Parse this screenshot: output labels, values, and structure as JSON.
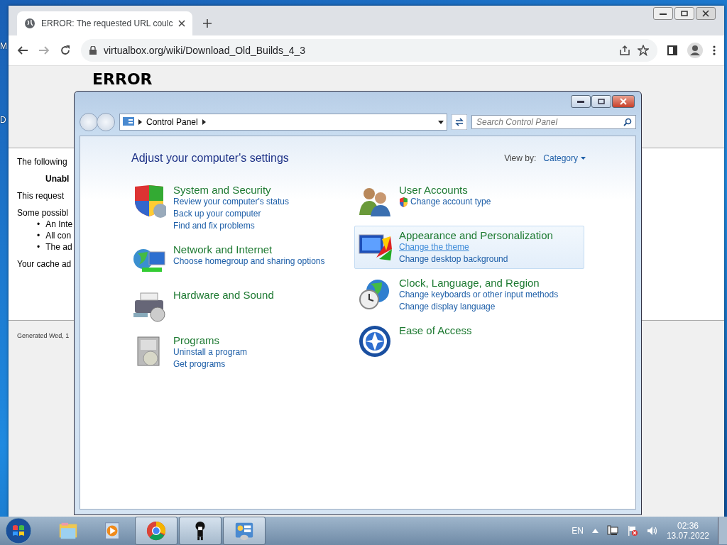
{
  "desktop": {
    "icon_labels": [
      "M",
      "D"
    ]
  },
  "browser": {
    "tabs": [
      {
        "title": "ERROR: The requested URL coulc",
        "selected": true
      }
    ],
    "address": "virtualbox.org/wiki/Download_Old_Builds_4_3",
    "page": {
      "heading": "ERROR",
      "lines": [
        {
          "kind": "para",
          "text": "The following"
        },
        {
          "kind": "bold",
          "text": "Unabl"
        },
        {
          "kind": "para",
          "text": "This request"
        },
        {
          "kind": "para",
          "text": "Some possibl"
        },
        {
          "kind": "bullet",
          "marker": "•",
          "text": "An Inte"
        },
        {
          "kind": "bullet",
          "marker": "•",
          "text": "All con"
        },
        {
          "kind": "bullet",
          "marker": "•",
          "text": "The ad"
        },
        {
          "kind": "para",
          "text": "Your cache ad"
        }
      ],
      "footer": "Generated Wed, 1"
    }
  },
  "control_panel": {
    "breadcrumb": [
      "Control Panel"
    ],
    "search": {
      "placeholder": "Search Control Panel"
    },
    "heading": "Adjust your computer's settings",
    "view_by": {
      "label": "View by:",
      "value": "Category"
    },
    "columns": [
      [
        {
          "title": "System and Security",
          "highlighted": false,
          "links": [
            {
              "text": "Review your computer's status",
              "kind": "plain",
              "hovered": false
            },
            {
              "text": "Back up your computer",
              "kind": "plain",
              "hovered": false
            },
            {
              "text": "Find and fix problems",
              "kind": "plain",
              "hovered": false
            }
          ]
        },
        {
          "title": "Network and Internet",
          "highlighted": false,
          "links": [
            {
              "text": "Choose homegroup and sharing options",
              "kind": "plain",
              "hovered": false
            }
          ]
        },
        {
          "title": "Hardware and Sound",
          "highlighted": false
        },
        {
          "title": "Programs",
          "highlighted": false,
          "links": [
            {
              "text": "Uninstall a program",
              "kind": "plain",
              "hovered": false
            },
            {
              "text": "Get programs",
              "kind": "plain",
              "hovered": false
            }
          ]
        }
      ],
      [
        {
          "title": "User Accounts",
          "highlighted": false,
          "links": [
            {
              "text": "Change account type",
              "kind": "shield",
              "hovered": false
            }
          ]
        },
        {
          "title": "Appearance and Personalization",
          "highlighted": true,
          "links": [
            {
              "text": "Change the theme",
              "kind": "plain",
              "hovered": true
            },
            {
              "text": "Change desktop background",
              "kind": "plain",
              "hovered": false
            }
          ]
        },
        {
          "title": "Clock, Language, and Region",
          "highlighted": false,
          "links": [
            {
              "text": "Change keyboards or other input methods",
              "kind": "plain",
              "hovered": false
            },
            {
              "text": "Change display language",
              "kind": "plain",
              "hovered": false
            }
          ]
        },
        {
          "title": "Ease of Access",
          "highlighted": false
        }
      ]
    ]
  },
  "taskbar": {
    "apps": [
      {
        "running": false
      },
      {
        "running": false
      },
      {
        "running": true
      },
      {
        "running": true
      },
      {
        "running": true
      }
    ],
    "language": "EN",
    "time": "02:36",
    "date": "13.07.2022"
  }
}
